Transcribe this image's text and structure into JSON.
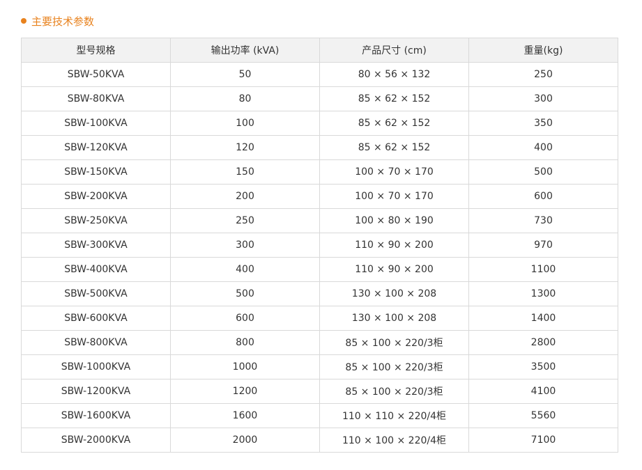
{
  "section": {
    "title": "主要技术参数"
  },
  "table": {
    "headers": [
      "型号规格",
      "输出功率 (kVA)",
      "产品尺寸 (cm)",
      "重量(kg)"
    ],
    "rows": [
      [
        "SBW-50KVA",
        "50",
        "80 × 56 × 132",
        "250"
      ],
      [
        "SBW-80KVA",
        "80",
        "85 × 62 × 152",
        "300"
      ],
      [
        "SBW-100KVA",
        "100",
        "85 × 62 × 152",
        "350"
      ],
      [
        "SBW-120KVA",
        "120",
        "85 × 62 × 152",
        "400"
      ],
      [
        "SBW-150KVA",
        "150",
        "100 × 70 × 170",
        "500"
      ],
      [
        "SBW-200KVA",
        "200",
        "100 × 70 × 170",
        "600"
      ],
      [
        "SBW-250KVA",
        "250",
        "100 × 80 × 190",
        "730"
      ],
      [
        "SBW-300KVA",
        "300",
        "110 × 90 × 200",
        "970"
      ],
      [
        "SBW-400KVA",
        "400",
        "110 × 90 × 200",
        "1100"
      ],
      [
        "SBW-500KVA",
        "500",
        "130 × 100 × 208",
        "1300"
      ],
      [
        "SBW-600KVA",
        "600",
        "130 × 100 × 208",
        "1400"
      ],
      [
        "SBW-800KVA",
        "800",
        "85 × 100 × 220/3柜",
        "2800"
      ],
      [
        "SBW-1000KVA",
        "1000",
        "85 × 100 × 220/3柜",
        "3500"
      ],
      [
        "SBW-1200KVA",
        "1200",
        "85 × 100 × 220/3柜",
        "4100"
      ],
      [
        "SBW-1600KVA",
        "1600",
        "110 × 110 × 220/4柜",
        "5560"
      ],
      [
        "SBW-2000KVA",
        "2000",
        "110 × 100 × 220/4柜",
        "7100"
      ]
    ]
  },
  "colors": {
    "accent": "#e8821e",
    "border": "#d9d9d9",
    "header_bg": "#f2f2f2"
  }
}
